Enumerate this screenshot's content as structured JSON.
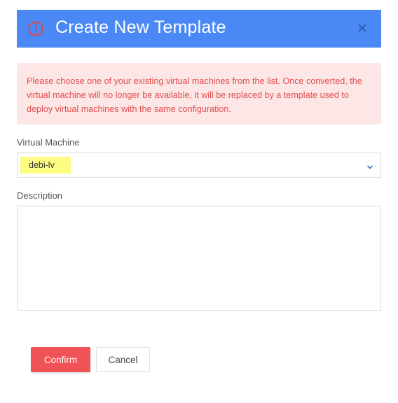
{
  "dialog": {
    "title": "Create New Template",
    "header_icon": "alert-circle-icon",
    "close_icon": "close-icon"
  },
  "alert": {
    "message": "Please choose one of your existing virtual machines from the list. Once converted, the virtual machine will no longer be available, it will be replaced by a template used to deploy virtual machines with the same configuration."
  },
  "form": {
    "vm_label": "Virtual Machine",
    "vm_value": "debi-lv",
    "description_label": "Description",
    "description_value": ""
  },
  "buttons": {
    "confirm": "Confirm",
    "cancel": "Cancel"
  },
  "colors": {
    "header": "#4a88f5",
    "alert_bg": "#fde6e6",
    "alert_text": "#e2504f",
    "confirm": "#f05355",
    "highlight": "#fdfd83"
  }
}
